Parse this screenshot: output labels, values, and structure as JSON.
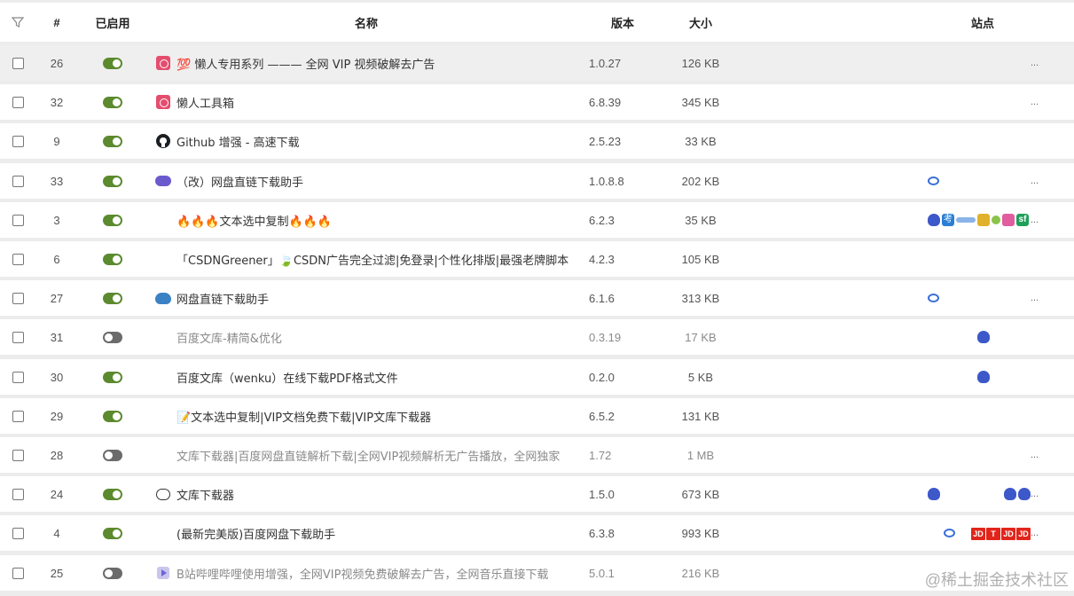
{
  "header": {
    "index": "#",
    "enabled": "已启用",
    "name": "名称",
    "version": "版本",
    "size": "大小",
    "site": "站点"
  },
  "rows": [
    {
      "index": "26",
      "enabled": true,
      "icon": "red-play-icon",
      "name": "💯 懒人专用系列 ——— 全网 VIP 视频破解去广告",
      "version": "1.0.27",
      "size": "126 KB",
      "sites": [],
      "more": "..."
    },
    {
      "index": "32",
      "enabled": true,
      "icon": "red-play-icon",
      "name": "懒人工具箱",
      "version": "6.8.39",
      "size": "345 KB",
      "sites": [],
      "more": "..."
    },
    {
      "index": "9",
      "enabled": true,
      "icon": "github-icon",
      "name": "Github 增强 - 高速下载",
      "version": "2.5.23",
      "size": "33 KB",
      "sites": [],
      "more": ""
    },
    {
      "index": "33",
      "enabled": true,
      "icon": "purple-cloud-icon",
      "name": "（改）网盘直链下载助手",
      "version": "1.0.8.8",
      "size": "202 KB",
      "sites": [
        "baidu-pan-icon"
      ],
      "more": "..."
    },
    {
      "index": "3",
      "enabled": true,
      "icon": "",
      "name": "🔥🔥🔥文本选中复制🔥🔥🔥",
      "version": "6.2.3",
      "size": "35 KB",
      "sites": [
        "baidu-icon",
        "kao-icon",
        "wide-icon",
        "cross-icon",
        "green-icon",
        "teal-icon",
        "sf-icon"
      ],
      "more": "..."
    },
    {
      "index": "6",
      "enabled": true,
      "icon": "",
      "name": "「CSDNGreener」🍃CSDN广告完全过滤|免登录|个性化排版|最强老牌脚本",
      "version": "4.2.3",
      "size": "105 KB",
      "sites": [],
      "more": ""
    },
    {
      "index": "27",
      "enabled": true,
      "icon": "blue-cloud-icon",
      "name": "网盘直链下载助手",
      "version": "6.1.6",
      "size": "313 KB",
      "sites": [
        "baidu-pan-icon"
      ],
      "more": "..."
    },
    {
      "index": "31",
      "enabled": false,
      "icon": "",
      "name": "百度文库-精简&优化",
      "version": "0.3.19",
      "size": "17 KB",
      "sites": [
        "baidu-icon-center"
      ],
      "more": ""
    },
    {
      "index": "30",
      "enabled": true,
      "icon": "",
      "name": "百度文库（wenku）在线下载PDF格式文件",
      "version": "0.2.0",
      "size": "5 KB",
      "sites": [
        "baidu-icon-center"
      ],
      "more": ""
    },
    {
      "index": "29",
      "enabled": true,
      "icon": "",
      "name": "📝文本选中复制|VIP文档免费下载|VIP文库下载器",
      "version": "6.5.2",
      "size": "131 KB",
      "sites": [],
      "more": ""
    },
    {
      "index": "28",
      "enabled": false,
      "icon": "",
      "name": "文库下载器|百度网盘直链解析下载|全网VIP视频解析无广告播放，全网独家",
      "version": "1.72",
      "size": "1 MB",
      "sites": [],
      "more": "..."
    },
    {
      "index": "24",
      "enabled": true,
      "icon": "cloud-download-icon",
      "name": "文库下载器",
      "version": "1.5.0",
      "size": "673 KB",
      "sites": [
        "baidu-icon",
        "baidu-icon-right",
        "baidu-icon-right2"
      ],
      "more": "..."
    },
    {
      "index": "4",
      "enabled": true,
      "icon": "",
      "name": "(最新完美版)百度网盘下载助手",
      "version": "6.3.8",
      "size": "993 KB",
      "sites": [
        "baidu-pan-icon-offset",
        "jd-icons"
      ],
      "more": "..."
    },
    {
      "index": "25",
      "enabled": false,
      "icon": "play-purple-icon",
      "name": "B站哔哩哔哩使用增强，全网VIP视频免费破解去广告，全网音乐直接下载",
      "version": "5.0.1",
      "size": "216 KB",
      "sites": [],
      "more": ""
    }
  ],
  "jd_label": "JD",
  "jd_t_label": "T",
  "kao_label": "考",
  "sf_label": "sf",
  "watermark": "@稀土掘金技术社区"
}
